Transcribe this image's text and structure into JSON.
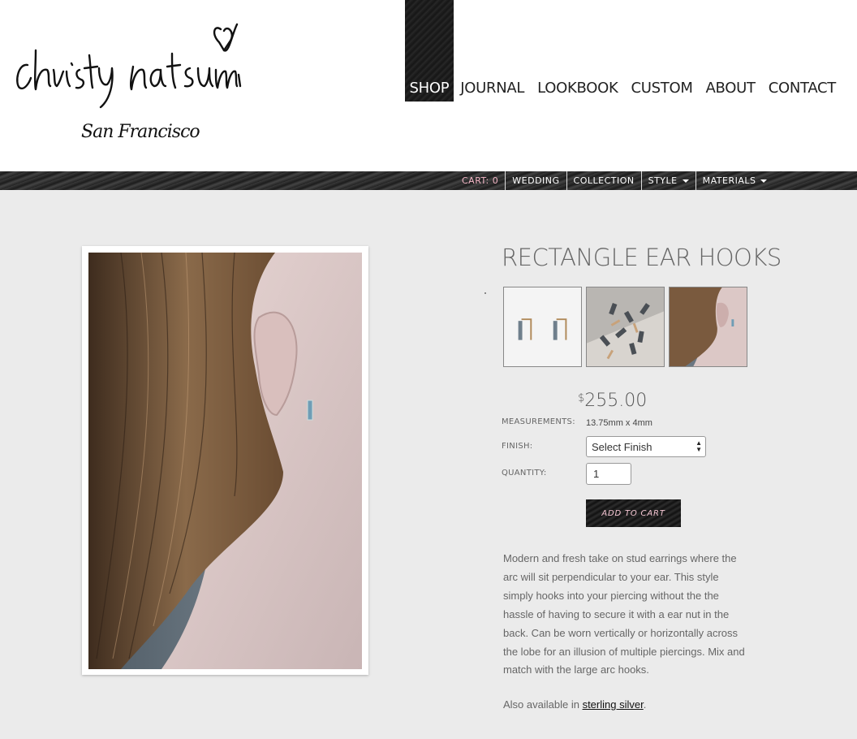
{
  "brand": {
    "logo_text": "christy natsumi",
    "tagline": "San Francisco"
  },
  "main_nav": [
    {
      "label": "SHOP",
      "active": true
    },
    {
      "label": "JOURNAL",
      "active": false
    },
    {
      "label": "LOOKBOOK",
      "active": false
    },
    {
      "label": "CUSTOM",
      "active": false
    },
    {
      "label": "ABOUT",
      "active": false
    },
    {
      "label": "CONTACT",
      "active": false
    }
  ],
  "sub_nav": {
    "cart": "CART: 0",
    "wedding": "WEDDING",
    "collection": "COLLECTION",
    "style": "STYLE",
    "materials": "MATERIALS"
  },
  "product": {
    "title": "RECTANGLE EAR HOOKS",
    "price_symbol": "$",
    "price": "255.00",
    "measurements_label": "MEASUREMENTS:",
    "measurements_value": "13.75mm x 4mm",
    "finish_label": "FINISH:",
    "finish_selected": "Select Finish",
    "quantity_label": "QUANTITY:",
    "quantity_value": "1",
    "add_to_cart": "ADD TO CART",
    "description": "Modern and fresh take on stud earrings where the arc will sit perpendicular to your ear.  This style simply hooks into your piercing without the the hassle of having to secure it with a ear nut in the back.  Can be worn vertically or horizontally across the lobe for an illusion of multiple piercings.  Mix and match with the large arc hooks.",
    "also_prefix": "Also available in ",
    "also_link": "sterling silver",
    "also_suffix": "."
  },
  "colors": {
    "accent_pink": "#f4b6c6",
    "nav_dark": "#1a1a1a",
    "page_bg": "#ebebeb"
  }
}
